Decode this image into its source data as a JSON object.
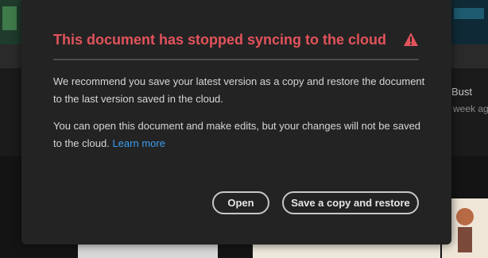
{
  "background": {
    "item_title": "Bust",
    "item_subtitle": "week ago"
  },
  "dialog": {
    "title": "This document has stopped syncing to the cloud",
    "icon": "alert-triangle-icon",
    "paragraph1": "We recommend you save your latest version as a copy and restore the document to the last version saved in the cloud.",
    "paragraph2": "You can open this document and make edits, but your changes will not be saved to the cloud.",
    "learn_more": "Learn more",
    "buttons": {
      "open": "Open",
      "save_copy": "Save a copy and restore"
    }
  },
  "colors": {
    "title": "#e2535b",
    "link": "#3c9cf0",
    "dialog_bg": "#232323"
  }
}
